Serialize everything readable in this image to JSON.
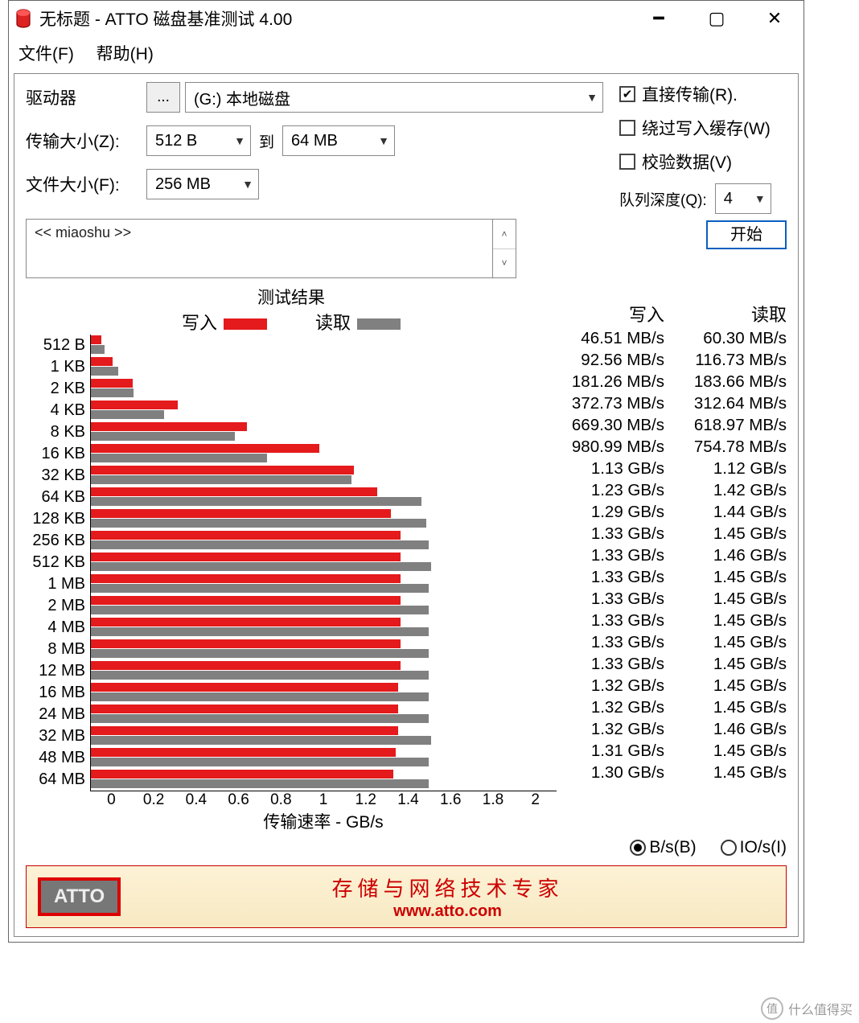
{
  "window": {
    "title": "无标题 - ATTO 磁盘基准测试 4.00",
    "menu": {
      "file": "文件(F)",
      "help": "帮助(H)"
    }
  },
  "controls": {
    "drive_label": "驱动器",
    "drive_btn": "...",
    "drive_value": "(G:) 本地磁盘",
    "transfer_size_label": "传输大小(Z):",
    "transfer_from": "512 B",
    "to_label": "到",
    "transfer_to": "64 MB",
    "file_size_label": "文件大小(F):",
    "file_size": "256 MB",
    "direct_io": "直接传输(R).",
    "bypass_cache": "绕过写入缓存(W)",
    "verify_data": "校验数据(V)",
    "queue_depth_label": "队列深度(Q):",
    "queue_depth": "4",
    "description": "<< miaoshu >>",
    "start": "开始"
  },
  "results": {
    "title": "测试结果",
    "write_label": "写入",
    "read_label": "读取",
    "xlabel": "传输速率 - GB/s",
    "xticks": [
      "0",
      "0.2",
      "0.4",
      "0.6",
      "0.8",
      "1",
      "1.2",
      "1.4",
      "1.6",
      "1.8",
      "2"
    ],
    "unit_bs": "B/s(B)",
    "unit_ios": "IO/s(I)"
  },
  "footer": {
    "logo": "ATTO",
    "tagline": "存储与网络技术专家",
    "url": "www.atto.com"
  },
  "watermark": {
    "icon": "值",
    "text": "什么值得买"
  },
  "chart_data": {
    "type": "bar",
    "title": "测试结果",
    "xlabel": "传输速率 - GB/s",
    "xlim": [
      0,
      2
    ],
    "categories": [
      "512 B",
      "1 KB",
      "2 KB",
      "4 KB",
      "8 KB",
      "16 KB",
      "32 KB",
      "64 KB",
      "128 KB",
      "256 KB",
      "512 KB",
      "1 MB",
      "2 MB",
      "4 MB",
      "8 MB",
      "12 MB",
      "16 MB",
      "24 MB",
      "32 MB",
      "48 MB",
      "64 MB"
    ],
    "series": [
      {
        "name": "写入",
        "display": [
          "46.51 MB/s",
          "92.56 MB/s",
          "181.26 MB/s",
          "372.73 MB/s",
          "669.30 MB/s",
          "980.99 MB/s",
          "1.13 GB/s",
          "1.23 GB/s",
          "1.29 GB/s",
          "1.33 GB/s",
          "1.33 GB/s",
          "1.33 GB/s",
          "1.33 GB/s",
          "1.33 GB/s",
          "1.33 GB/s",
          "1.33 GB/s",
          "1.32 GB/s",
          "1.32 GB/s",
          "1.32 GB/s",
          "1.31 GB/s",
          "1.30 GB/s"
        ],
        "values_gbps": [
          0.04651,
          0.09256,
          0.18126,
          0.37273,
          0.6693,
          0.98099,
          1.13,
          1.23,
          1.29,
          1.33,
          1.33,
          1.33,
          1.33,
          1.33,
          1.33,
          1.33,
          1.32,
          1.32,
          1.32,
          1.31,
          1.3
        ]
      },
      {
        "name": "读取",
        "display": [
          "60.30 MB/s",
          "116.73 MB/s",
          "183.66 MB/s",
          "312.64 MB/s",
          "618.97 MB/s",
          "754.78 MB/s",
          "1.12 GB/s",
          "1.42 GB/s",
          "1.44 GB/s",
          "1.45 GB/s",
          "1.46 GB/s",
          "1.45 GB/s",
          "1.45 GB/s",
          "1.45 GB/s",
          "1.45 GB/s",
          "1.45 GB/s",
          "1.45 GB/s",
          "1.45 GB/s",
          "1.46 GB/s",
          "1.45 GB/s",
          "1.45 GB/s"
        ],
        "values_gbps": [
          0.0603,
          0.11673,
          0.18366,
          0.31264,
          0.61897,
          0.75478,
          1.12,
          1.42,
          1.44,
          1.45,
          1.46,
          1.45,
          1.45,
          1.45,
          1.45,
          1.45,
          1.45,
          1.45,
          1.46,
          1.45,
          1.45
        ]
      }
    ]
  }
}
